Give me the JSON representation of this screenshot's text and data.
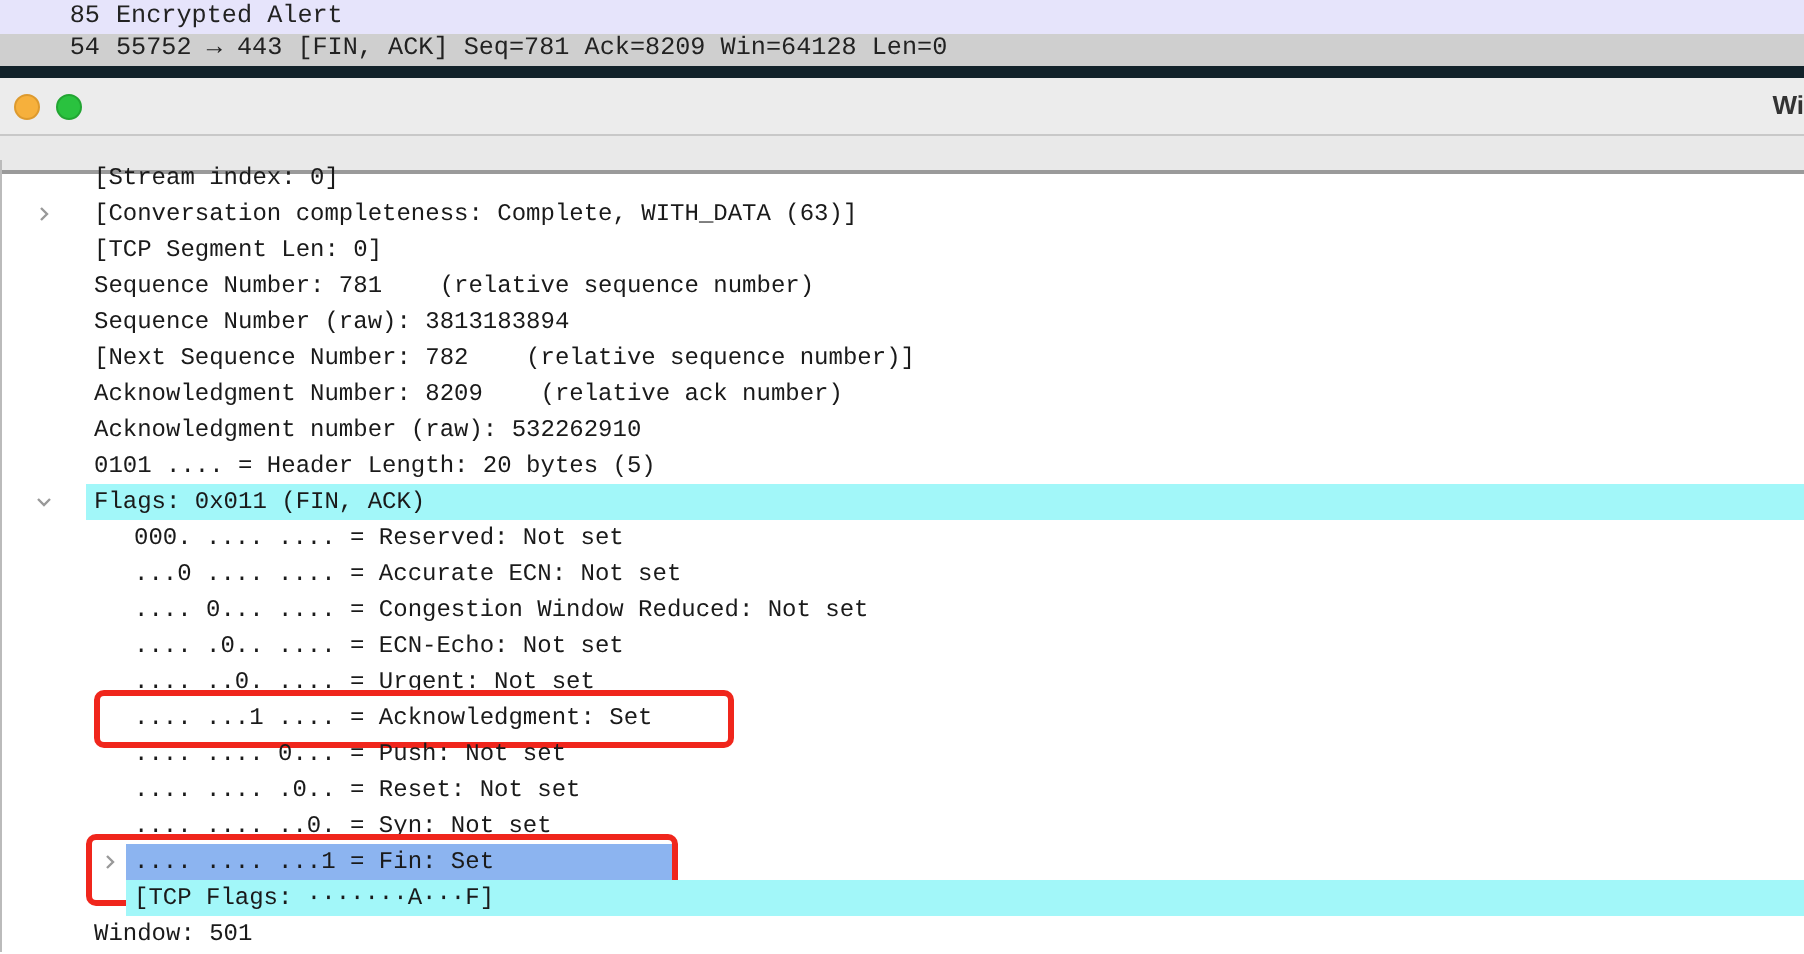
{
  "packet_list": [
    {
      "length": "85",
      "info": "Encrypted Alert",
      "selected": false
    },
    {
      "length": "54",
      "info": "55752 → 443 [FIN, ACK] Seq=781 Ack=8209 Win=64128 Len=0",
      "selected": true
    }
  ],
  "window": {
    "title": "Wi"
  },
  "details": [
    {
      "text": "[Stream index: 0]"
    },
    {
      "text": "[Conversation completeness: Complete, WITH_DATA (63)]",
      "expandable": true,
      "expanded": false
    },
    {
      "text": "[TCP Segment Len: 0]"
    },
    {
      "text": "Sequence Number: 781    (relative sequence number)"
    },
    {
      "text": "Sequence Number (raw): 3813183894"
    },
    {
      "text": "[Next Sequence Number: 782    (relative sequence number)]"
    },
    {
      "text": "Acknowledgment Number: 8209    (relative ack number)"
    },
    {
      "text": "Acknowledgment number (raw): 532262910"
    },
    {
      "text": "0101 .... = Header Length: 20 bytes (5)"
    },
    {
      "text": "Flags: 0x011 (FIN, ACK)",
      "expandable": true,
      "expanded": true,
      "related": true,
      "children": [
        {
          "text": "000. .... .... = Reserved: Not set"
        },
        {
          "text": "...0 .... .... = Accurate ECN: Not set"
        },
        {
          "text": ".... 0... .... = Congestion Window Reduced: Not set"
        },
        {
          "text": ".... .0.. .... = ECN-Echo: Not set"
        },
        {
          "text": ".... ..0. .... = Urgent: Not set"
        },
        {
          "text": ".... ...1 .... = Acknowledgment: Set",
          "annotated": true
        },
        {
          "text": ".... .... 0... = Push: Not set"
        },
        {
          "text": ".... .... .0.. = Reset: Not set"
        },
        {
          "text": ".... .... ..0. = Syn: Not set"
        },
        {
          "text": ".... .... ...1 = Fin: Set",
          "expandable": true,
          "expanded": false,
          "selected": true,
          "annotated": true
        },
        {
          "text": "[TCP Flags: ·······A···F]",
          "related": true
        }
      ]
    },
    {
      "text": "Window: 501"
    }
  ]
}
